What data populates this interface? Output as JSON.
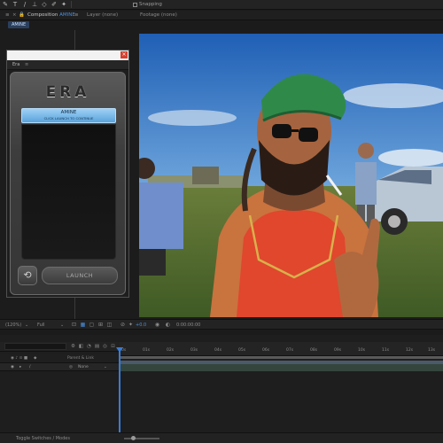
{
  "toolbar": {
    "tools": [
      {
        "name": "pen-icon",
        "glyph": "✎"
      },
      {
        "name": "text-tool-icon",
        "glyph": "T"
      },
      {
        "name": "brush-icon",
        "glyph": "/"
      },
      {
        "name": "clone-stamp-icon",
        "glyph": "⊥"
      },
      {
        "name": "eraser-icon",
        "glyph": "◇"
      },
      {
        "name": "roto-brush-icon",
        "glyph": "✐"
      },
      {
        "name": "puppet-pin-icon",
        "glyph": "✦"
      }
    ],
    "snapping_label": "Snapping"
  },
  "panels": {
    "composition_prefix": "Composition",
    "composition_name": "AMINE",
    "layer_label": "Layer (none)",
    "footage_label": "Footage (none)",
    "comp_tab": "AMINE"
  },
  "plugin": {
    "tab_label": "Era",
    "menu_icon": "≡",
    "close_glyph": "×",
    "logo_text": "ERA",
    "project_name": "AMINE",
    "project_hint": "CLICK LAUNCH TO CONTINUE",
    "refresh_glyph": "⟲",
    "launch_label": "LAUNCH"
  },
  "viewer_bar": {
    "zoom": "(120%)",
    "resolution": "Full",
    "timecode": "0:00:00:00"
  },
  "timeline": {
    "columns": {
      "parent": "Parent & Link"
    },
    "layer": {
      "parent_value": "None"
    },
    "ruler_ticks": [
      "0s",
      "01s",
      "02s",
      "03s",
      "04s",
      "05s",
      "06s",
      "07s",
      "08s",
      "09s",
      "10s",
      "11s",
      "12s",
      "13s"
    ],
    "footer_label": "Toggle Switches / Modes"
  },
  "colors": {
    "accent": "#4a8fe0",
    "launch_blue": "#5aa3db",
    "close_red": "#d6402e"
  }
}
